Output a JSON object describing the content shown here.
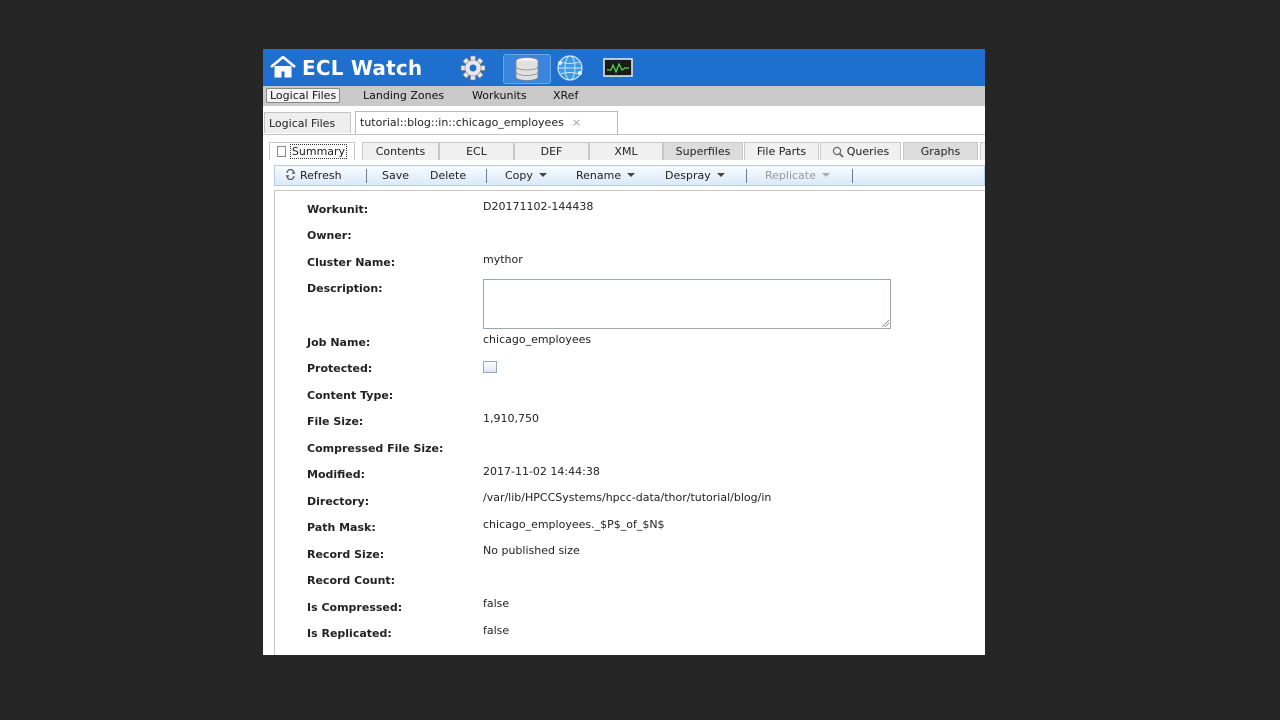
{
  "header": {
    "title": "ECL Watch",
    "icons": [
      "home-icon",
      "gear-icon",
      "database-icon",
      "globe-icon",
      "monitor-icon"
    ]
  },
  "main_menu": [
    "Logical Files",
    "Landing Zones",
    "Workunits",
    "XRef"
  ],
  "doc_tabs": {
    "items": [
      "Logical Files",
      "tutorial::blog::in::chicago_employees"
    ],
    "close": "×"
  },
  "sub_tabs": [
    "Summary",
    "Contents",
    "ECL",
    "DEF",
    "XML",
    "Superfiles",
    "File Parts",
    "Queries",
    "Graphs"
  ],
  "toolbar": {
    "refresh": "Refresh",
    "save": "Save",
    "delete": "Delete",
    "copy": "Copy",
    "rename": "Rename",
    "despray": "Despray",
    "replicate": "Replicate"
  },
  "fields": {
    "workunit": {
      "label": "Workunit:",
      "value": "D20171102-144438"
    },
    "owner": {
      "label": "Owner:",
      "value": ""
    },
    "cluster_name": {
      "label": "Cluster Name:",
      "value": "mythor"
    },
    "description": {
      "label": "Description:",
      "value": ""
    },
    "job_name": {
      "label": "Job Name:",
      "value": "chicago_employees"
    },
    "protected": {
      "label": "Protected:",
      "checked": false
    },
    "content_type": {
      "label": "Content Type:",
      "value": ""
    },
    "file_size": {
      "label": "File Size:",
      "value": "1,910,750"
    },
    "compressed_file_size": {
      "label": "Compressed File Size:",
      "value": ""
    },
    "modified": {
      "label": "Modified:",
      "value": "2017-11-02 14:44:38"
    },
    "directory": {
      "label": "Directory:",
      "value": "/var/lib/HPCCSystems/hpcc-data/thor/tutorial/blog/in"
    },
    "path_mask": {
      "label": "Path Mask:",
      "value": "chicago_employees._$P$_of_$N$"
    },
    "record_size": {
      "label": "Record Size:",
      "value": "No published size"
    },
    "record_count": {
      "label": "Record Count:",
      "value": ""
    },
    "is_compressed": {
      "label": "Is Compressed:",
      "value": "false"
    },
    "is_replicated": {
      "label": "Is Replicated:",
      "value": "false"
    }
  }
}
